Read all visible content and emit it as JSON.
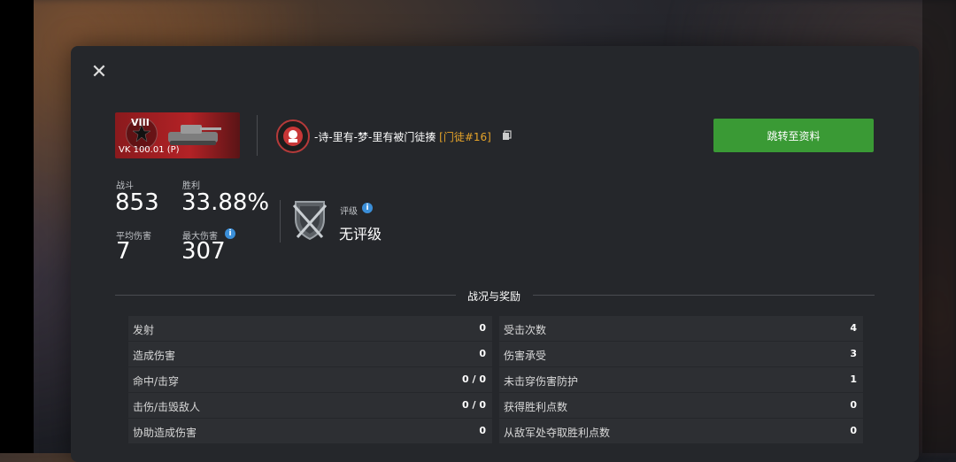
{
  "player": {
    "name": "-诗-里有-梦-里有被门徒揍",
    "clan_tag": "[门徒#16]"
  },
  "tank": {
    "tier": "VIII",
    "name": "VK 100.01 (P)"
  },
  "buttons": {
    "profile": "跳转至资料"
  },
  "stats": {
    "battles_label": "战斗",
    "battles_value": "853",
    "wins_label": "胜利",
    "wins_value": "33.88%",
    "avg_damage_label": "平均伤害",
    "avg_damage_value": "7",
    "max_damage_label": "最大伤害",
    "max_damage_value": "307"
  },
  "rating": {
    "label": "评级",
    "value": "无评级"
  },
  "section": {
    "title": "战况与奖励"
  },
  "table": {
    "left": [
      {
        "label": "发射",
        "value": "0"
      },
      {
        "label": "造成伤害",
        "value": "0"
      },
      {
        "label": "命中/击穿",
        "value": "0 / 0"
      },
      {
        "label": "击伤/击毁敌人",
        "value": "0 / 0"
      },
      {
        "label": "协助造成伤害",
        "value": "0"
      }
    ],
    "right": [
      {
        "label": "受击次数",
        "value": "4"
      },
      {
        "label": "伤害承受",
        "value": "3"
      },
      {
        "label": "未击穿伤害防护",
        "value": "1"
      },
      {
        "label": "获得胜利点数",
        "value": "0"
      },
      {
        "label": "从敌军处夺取胜利点数",
        "value": "0"
      }
    ]
  },
  "colors": {
    "accent_green": "#3a9a35",
    "clan_gold": "#e5a329",
    "info_blue": "#3b8fd9",
    "tank_card_red": "#b32226"
  },
  "icons": {
    "close": "close-icon",
    "copy": "copy-icon",
    "info": "info-icon",
    "rating": "rating-shield-icon",
    "clan": "clan-emblem-icon"
  }
}
